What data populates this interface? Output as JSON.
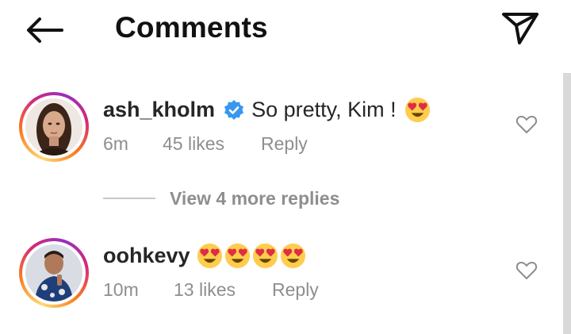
{
  "header": {
    "title": "Comments"
  },
  "comments": [
    {
      "username": "ash_kholm",
      "verified": true,
      "text": "So pretty, Kim !",
      "emojis": [
        "heart-eyes"
      ],
      "time": "6m",
      "likes": "45 likes",
      "reply_label": "Reply",
      "view_replies_label": "View 4 more replies"
    },
    {
      "username": "oohkevy",
      "verified": false,
      "text": "",
      "emojis": [
        "heart-eyes",
        "heart-eyes",
        "heart-eyes",
        "heart-eyes"
      ],
      "time": "10m",
      "likes": "13 likes",
      "reply_label": "Reply"
    }
  ],
  "colors": {
    "text": "#262626",
    "secondary_text": "#8e8e8e",
    "verified_blue": "#3897f0",
    "story_ring": [
      "#feda75",
      "#fa7e1e",
      "#d62976",
      "#962fbf"
    ]
  }
}
